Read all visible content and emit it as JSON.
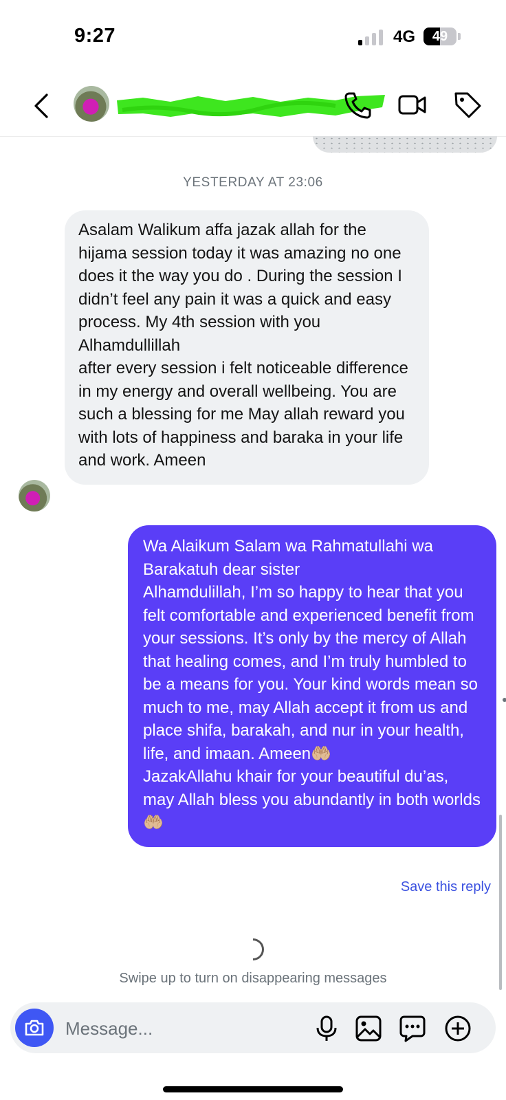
{
  "status_bar": {
    "time": "9:27",
    "network": "4G",
    "battery": "49",
    "battery_level": 0.49,
    "signal_bars_active": 1
  },
  "header": {
    "contact_name": "",
    "icons": {
      "back": "chevron-left-icon",
      "phone": "phone-icon",
      "video": "video-camera-icon",
      "tag": "tag-icon"
    }
  },
  "chat": {
    "timestamp": "YESTERDAY AT 23:06",
    "incoming": {
      "paragraphs": [
        "Asalam Walikum affa jazak allah for the hijama session today it was amazing no one does it the way you do . During the session I didn’t feel any pain it was a quick and easy process. My 4th session with  you Alhamdullillah",
        "after every session i felt noticeable difference in my energy and overall wellbeing. You are such a blessing for me  May allah reward you with lots of happiness and baraka in your life and work. Ameen"
      ]
    },
    "outgoing": {
      "paragraphs": [
        "Wa Alaikum Salam wa Rahmatullahi wa Barakatuh dear sister",
        "Alhamdulillah, I’m so happy to hear that you felt comfortable and experienced benefit from your sessions. It’s only by the mercy of Allah that healing comes, and I’m truly humbled to be a means for you. Your kind words mean so much to me, may Allah accept it from us and place shifa, barakah, and nur in your health, life, and imaan. Ameen🤲🏼",
        "JazakAllahu khair for your beautiful du’as, may Allah bless you abundantly in both worlds🤲🏼"
      ],
      "color": "#5a3ef7"
    },
    "save_reply": "Save this reply",
    "disappearing_hint": "Swipe up to turn on disappearing messages"
  },
  "composer": {
    "placeholder": "Message...",
    "icons": [
      "camera-icon",
      "microphone-icon",
      "gallery-icon",
      "sticker-icon",
      "plus-circle-icon"
    ]
  },
  "colors": {
    "accent": "#3f57f4",
    "incoming_bubble": "#eff1f3",
    "link": "#3b51e0"
  }
}
